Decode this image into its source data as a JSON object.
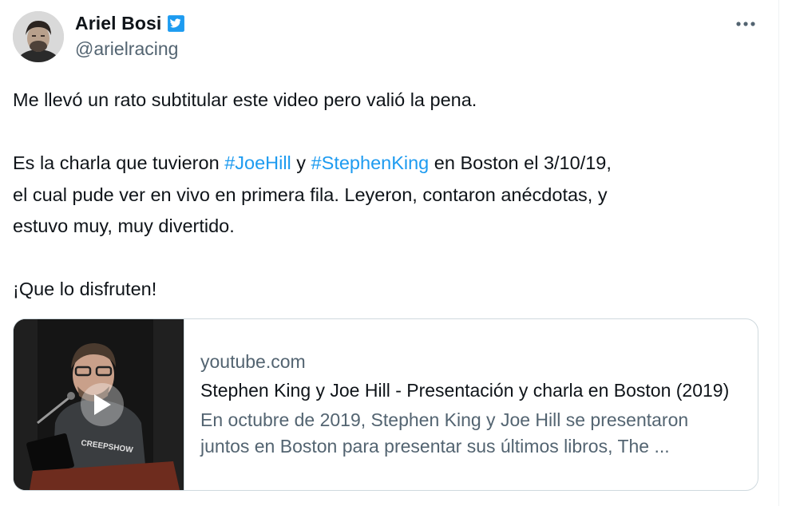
{
  "author": {
    "display_name": "Ariel Bosi",
    "handle": "@arielracing",
    "verified_badge_icon": "verified-badge-icon",
    "avatar_icon": "avatar-photo"
  },
  "more_icon": "more-horizontal-icon",
  "tweet": {
    "line1": "Me llevó un rato subtitular este video pero valió la pena.",
    "para2": {
      "pre": "Es la charla que tuvieron ",
      "hashtag1": "#JoeHill",
      "mid": " y ",
      "hashtag2": "#StephenKing",
      "post": " en Boston el 3/10/19,",
      "line2": "el cual pude ver en vivo en primera fila. Leyeron, contaron anécdotas, y",
      "line3": "estuvo muy, muy divertido."
    },
    "line_last": "¡Que lo disfruten!"
  },
  "link_card": {
    "domain": "youtube.com",
    "title": "Stephen King y Joe Hill - Presentación y charla en Boston (2019)",
    "description_line1": "En octubre de 2019, Stephen King y Joe Hill se presentaron",
    "description_line2": "juntos en Boston para presentar sus últimos libros, The ...",
    "thumbnail_shirt_text": "CREEPSHOW",
    "play_icon": "play-icon"
  },
  "colors": {
    "link": "#1d9bf0",
    "secondary_text": "#536471",
    "primary_text": "#0f1419",
    "border": "#cfd9de"
  }
}
